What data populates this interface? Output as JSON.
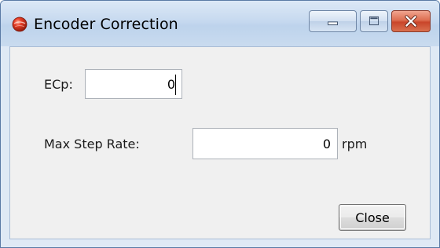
{
  "window": {
    "title": "Encoder Correction",
    "icon": "red-sphere-app-icon"
  },
  "caption_buttons": {
    "minimize_icon": "minimize-icon",
    "maximize_icon": "maximize-icon",
    "close_icon": "close-icon"
  },
  "form": {
    "ecp_label": "ECp:",
    "ecp_value": "0",
    "max_step_rate_label": "Max Step Rate:",
    "max_step_rate_value": "0",
    "max_step_rate_unit": "rpm"
  },
  "buttons": {
    "close_label": "Close"
  },
  "colors": {
    "title_bar": "#c6d9ef",
    "close_button": "#c9452a",
    "client_background": "#f0f0f0"
  }
}
